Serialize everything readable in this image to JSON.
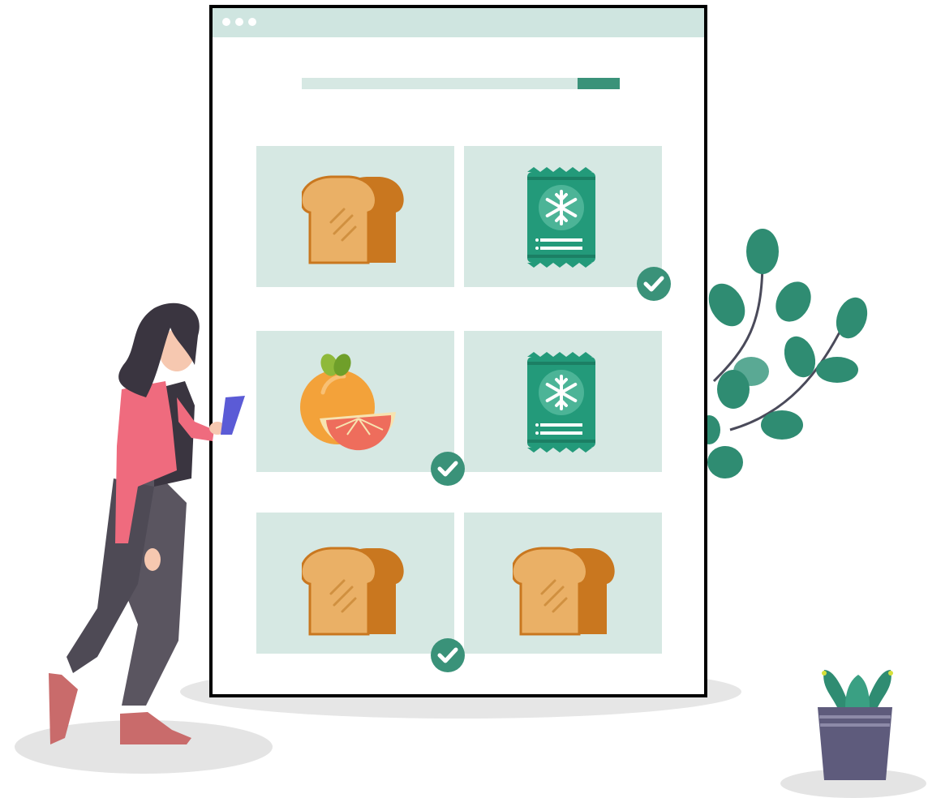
{
  "colors": {
    "accent": "#3a9279",
    "tile_bg": "#d6e8e3",
    "title_bar": "#cfe5e0",
    "bread_light": "#eab066",
    "bread_dark": "#c9771f",
    "orange": "#f3a23a",
    "check": "#3a9279"
  },
  "grid": {
    "tiles": [
      {
        "item": "bread-icon",
        "checked": false
      },
      {
        "item": "frozen-food-bag-icon",
        "checked": true
      },
      {
        "item": "orange-grapefruit-icon",
        "checked": true
      },
      {
        "item": "frozen-food-bag-icon",
        "checked": false
      },
      {
        "item": "bread-icon",
        "checked": true
      },
      {
        "item": "bread-icon",
        "checked": false
      }
    ]
  }
}
